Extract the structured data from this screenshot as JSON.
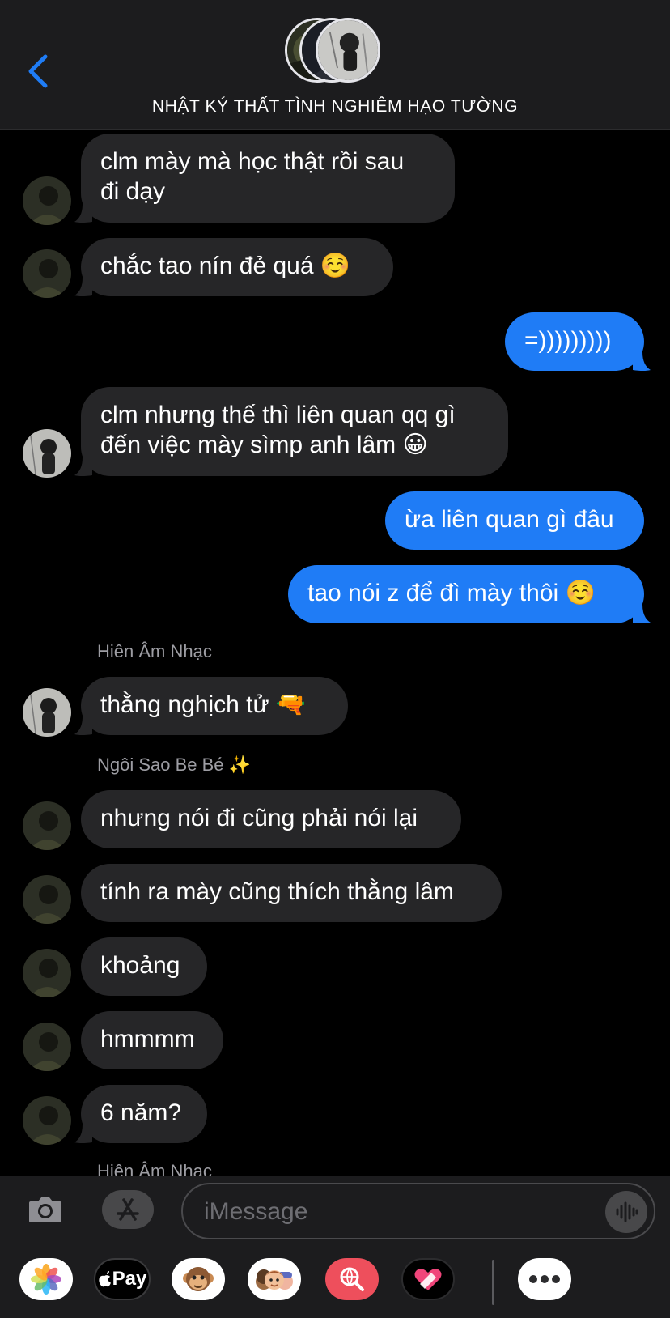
{
  "header": {
    "title": "NHẬT KÝ THẤT TÌNH NGHIÊM HẠO TƯỜNG",
    "back_icon": "chevron-left-icon",
    "accent_color": "#1f7cf6"
  },
  "messages": [
    {
      "direction": "in",
      "text": "clm mày mà học thật rồi sau\nđi dạy"
    },
    {
      "direction": "in",
      "text": "chắc tao nín đẻ quá ☺️"
    },
    {
      "direction": "out",
      "text": "=)))))))))"
    },
    {
      "direction": "in",
      "text": "clm nhưng thế thì liên quan qq gì\nđến việc mày sìmp anh lâm 😀"
    },
    {
      "direction": "out",
      "text": "ừa liên quan gì đâu"
    },
    {
      "direction": "out",
      "text": "tao nói z để đì mày thôi ☺️"
    },
    {
      "sender": "Hiên Âm Nhạc"
    },
    {
      "direction": "in",
      "text": "thằng nghịch tử 🔫"
    },
    {
      "sender": "Ngôi Sao Be Bé ✨"
    },
    {
      "direction": "in",
      "text": "nhưng nói đi cũng phải nói lại"
    },
    {
      "direction": "in",
      "text": "tính ra mày cũng thích thằng lâm"
    },
    {
      "direction": "in",
      "text": "khoảng"
    },
    {
      "direction": "in",
      "text": "hmmmm"
    },
    {
      "direction": "in",
      "text": "6 năm?"
    },
    {
      "sender": "Hiên Âm Nhạc"
    }
  ],
  "input": {
    "placeholder": "iMessage",
    "value": ""
  },
  "drawer": {
    "apps": [
      "photos-app-icon",
      "apple-pay-icon",
      "animoji-icon",
      "memoji-icon",
      "web-images-search-icon",
      "digital-touch-icon",
      "more-apps-icon"
    ],
    "apple_pay_label": "Pay"
  },
  "colors": {
    "incoming_bubble": "#262628",
    "outgoing_bubble": "#1f7cf6",
    "background": "#000000",
    "sender_name": "#9d9da3"
  }
}
